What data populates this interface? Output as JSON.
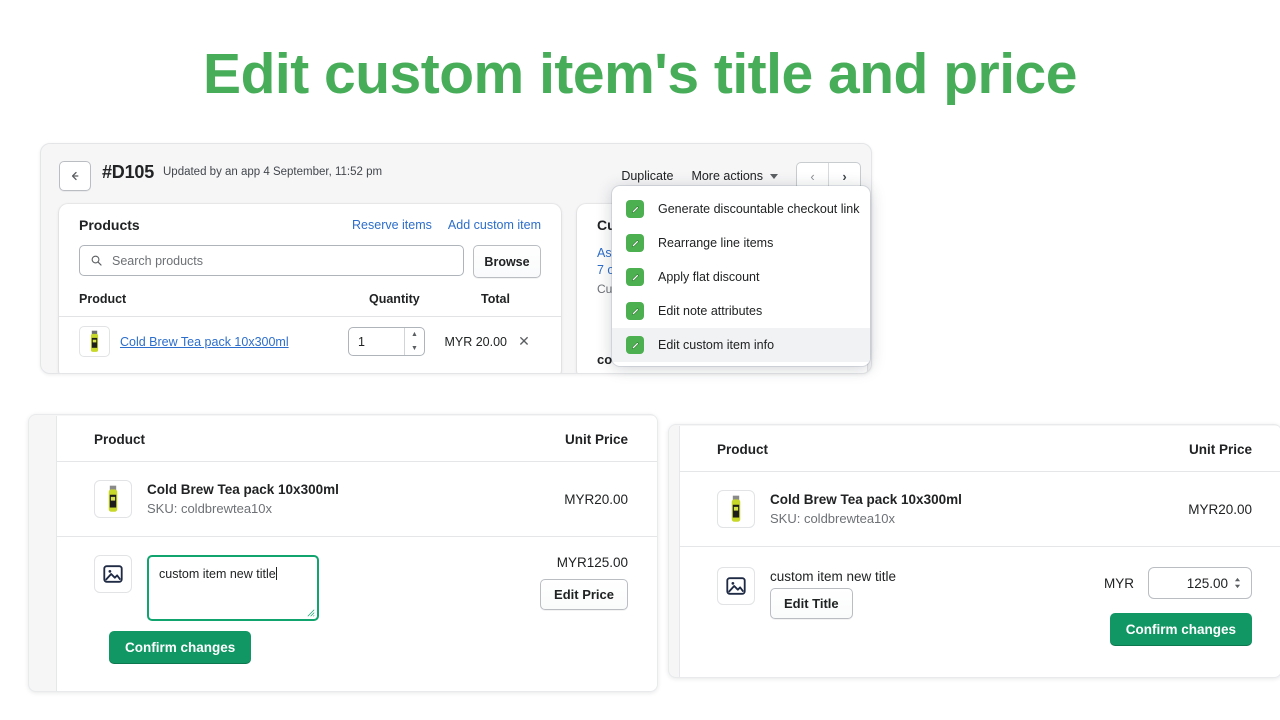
{
  "headline": "Edit custom item's title and price",
  "top_panel": {
    "back_icon": "arrow-left-icon",
    "order_number": "#D105",
    "order_meta": "Updated by an app 4 September, 11:52 pm",
    "duplicate_label": "Duplicate",
    "more_actions_label": "More actions",
    "pager_prev": "‹",
    "pager_next": "›",
    "products_card": {
      "title": "Products",
      "reserve_link": "Reserve items",
      "add_custom_link": "Add custom item",
      "search_placeholder": "Search products",
      "browse_label": "Browse",
      "columns": [
        "Product",
        "Quantity",
        "Total"
      ],
      "rows": [
        {
          "name": "Cold Brew Tea pack 10x300ml",
          "quantity": "1",
          "total": "MYR 20.00",
          "remove": "✕"
        }
      ]
    },
    "customer_card": {
      "title": "Cu",
      "link1": "As",
      "link2": "7 o",
      "muted": "Cu",
      "bottom": "co"
    }
  },
  "dropdown": {
    "items": [
      {
        "label": "Generate discountable checkout link",
        "icon": "pencil-icon",
        "selected": false
      },
      {
        "label": "Rearrange line items",
        "icon": "pencil-icon",
        "selected": false
      },
      {
        "label": "Apply flat discount",
        "icon": "pencil-icon",
        "selected": false
      },
      {
        "label": "Edit note attributes",
        "icon": "pencil-icon",
        "selected": false
      },
      {
        "label": "Edit custom item info",
        "icon": "pencil-icon",
        "selected": true
      }
    ]
  },
  "left_card": {
    "columns": {
      "product": "Product",
      "unit_price": "Unit Price"
    },
    "product_row": {
      "name": "Cold Brew Tea pack 10x300ml",
      "sku": "SKU: coldbrewtea10x",
      "unit_price": "MYR20.00"
    },
    "custom_row": {
      "title_value": "custom item new title",
      "price": "MYR125.00",
      "edit_price_label": "Edit Price"
    },
    "confirm_label": "Confirm changes"
  },
  "right_card": {
    "columns": {
      "product": "Product",
      "unit_price": "Unit Price"
    },
    "product_row": {
      "name": "Cold Brew Tea pack 10x300ml",
      "sku": "SKU: coldbrewtea10x",
      "unit_price": "MYR20.00"
    },
    "custom_row": {
      "title": "custom item new title",
      "edit_title_label": "Edit Title",
      "currency": "MYR",
      "price_value": "125.00"
    },
    "confirm_label": "Confirm changes"
  },
  "colors": {
    "headline_green": "#47ad59",
    "primary_green": "#119764",
    "focus_green": "#12a46f",
    "icon_green": "#4caf50",
    "link_blue": "#2c6ecb"
  }
}
